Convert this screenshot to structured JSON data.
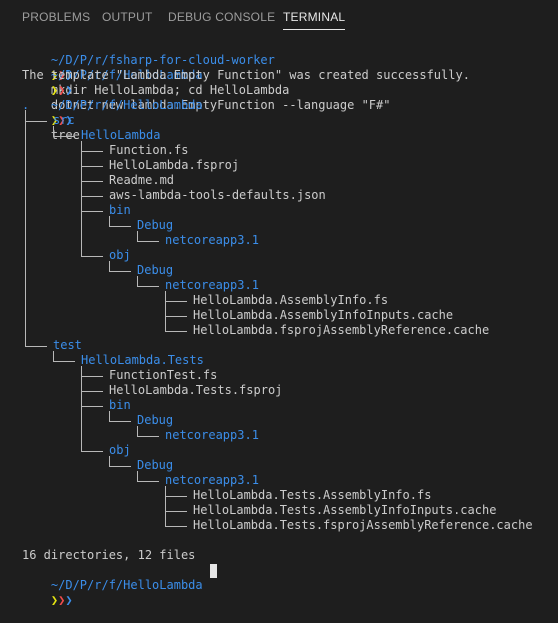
{
  "panel": {
    "tabs": [
      {
        "label": "PROBLEMS"
      },
      {
        "label": "OUTPUT"
      },
      {
        "label": "DEBUG CONSOLE"
      },
      {
        "label": "TERMINAL"
      }
    ],
    "active_tab": "TERMINAL"
  },
  "terminal": {
    "prompt_arrows": "❯❯❯",
    "commands": [
      {
        "path": "~/D/P/r/fsharp-for-cloud-worker",
        "command": "mkdir HelloLambda; cd HelloLambda"
      },
      {
        "path": "~/D/P/r/f/HelloLambda",
        "command": "dotnet new lambda.EmptyFunction --language \"F#\""
      },
      {
        "output": "The template \"Lambda Empty Function\" was created successfully."
      },
      {
        "path": "~/D/P/r/f/HelloLambda",
        "command": "tree"
      }
    ],
    "tree_root": ".",
    "tree": [
      {
        "name": "src",
        "kind": "dir",
        "depth": 0
      },
      {
        "name": "HelloLambda",
        "kind": "dir",
        "depth": 1
      },
      {
        "name": "Function.fs",
        "kind": "file",
        "depth": 2
      },
      {
        "name": "HelloLambda.fsproj",
        "kind": "file",
        "depth": 2
      },
      {
        "name": "Readme.md",
        "kind": "file",
        "depth": 2
      },
      {
        "name": "aws-lambda-tools-defaults.json",
        "kind": "file",
        "depth": 2
      },
      {
        "name": "bin",
        "kind": "dir",
        "depth": 2
      },
      {
        "name": "Debug",
        "kind": "dir",
        "depth": 3
      },
      {
        "name": "netcoreapp3.1",
        "kind": "dir",
        "depth": 4
      },
      {
        "name": "obj",
        "kind": "dir",
        "depth": 2
      },
      {
        "name": "Debug",
        "kind": "dir",
        "depth": 3
      },
      {
        "name": "netcoreapp3.1",
        "kind": "dir",
        "depth": 4
      },
      {
        "name": "HelloLambda.AssemblyInfo.fs",
        "kind": "file",
        "depth": 5
      },
      {
        "name": "HelloLambda.AssemblyInfoInputs.cache",
        "kind": "file",
        "depth": 5
      },
      {
        "name": "HelloLambda.fsprojAssemblyReference.cache",
        "kind": "file",
        "depth": 5
      },
      {
        "name": "test",
        "kind": "dir",
        "depth": 0
      },
      {
        "name": "HelloLambda.Tests",
        "kind": "dir",
        "depth": 1
      },
      {
        "name": "FunctionTest.fs",
        "kind": "file",
        "depth": 2
      },
      {
        "name": "HelloLambda.Tests.fsproj",
        "kind": "file",
        "depth": 2
      },
      {
        "name": "bin",
        "kind": "dir",
        "depth": 2
      },
      {
        "name": "Debug",
        "kind": "dir",
        "depth": 3
      },
      {
        "name": "netcoreapp3.1",
        "kind": "dir",
        "depth": 4
      },
      {
        "name": "obj",
        "kind": "dir",
        "depth": 2
      },
      {
        "name": "Debug",
        "kind": "dir",
        "depth": 3
      },
      {
        "name": "netcoreapp3.1",
        "kind": "dir",
        "depth": 4
      },
      {
        "name": "HelloLambda.Tests.AssemblyInfo.fs",
        "kind": "file",
        "depth": 5
      },
      {
        "name": "HelloLambda.Tests.AssemblyInfoInputs.cache",
        "kind": "file",
        "depth": 5
      },
      {
        "name": "HelloLambda.Tests.fsprojAssemblyReference.cache",
        "kind": "file",
        "depth": 5
      }
    ],
    "summary": "16 directories, 12 files",
    "final_prompt_path": "~/D/P/r/f/HelloLambda",
    "colors": {
      "background": "#1e1e1e",
      "path": "#3b8eea",
      "arrow_yellow": "#e5e510",
      "arrow_red": "#f14c4c",
      "arrow_blue": "#3b8eea",
      "text": "#cccccc"
    }
  }
}
